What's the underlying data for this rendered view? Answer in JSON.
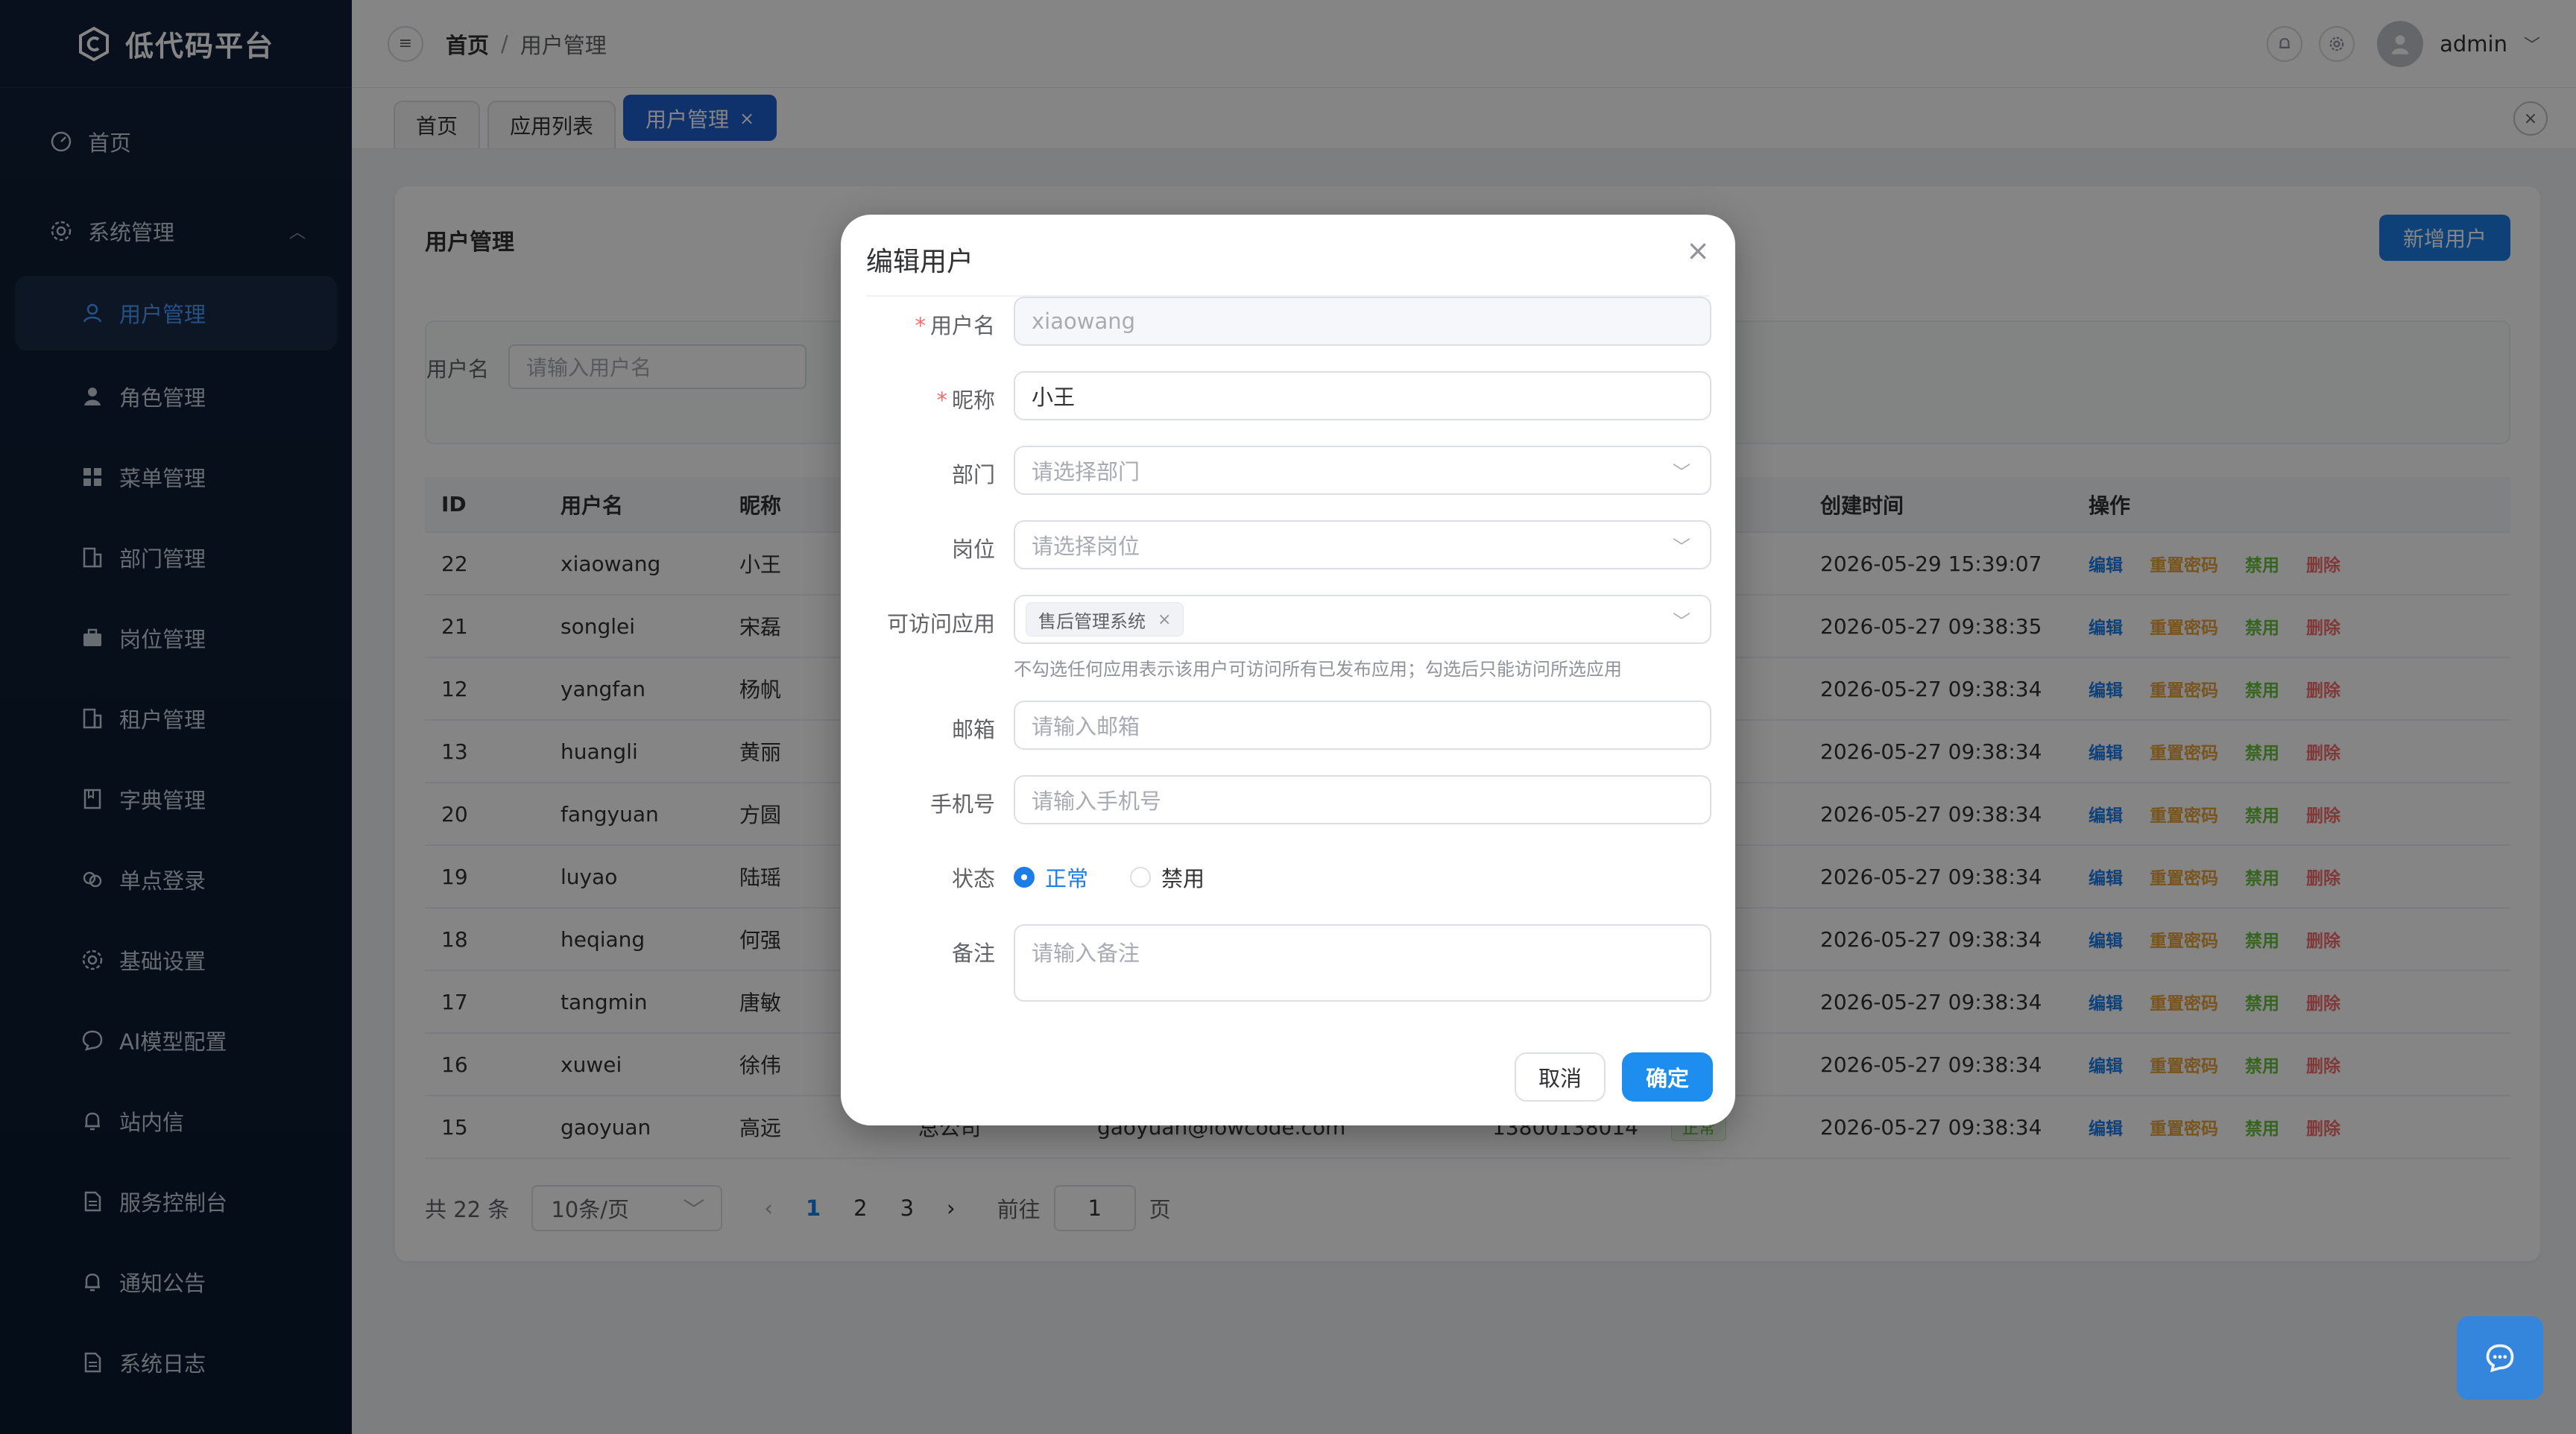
{
  "app": {
    "title": "低代码平台"
  },
  "sidebar": {
    "home": "首页",
    "group": "系统管理",
    "items": [
      {
        "label": "用户管理",
        "icon": "user-icon"
      },
      {
        "label": "角色管理",
        "icon": "role-icon"
      },
      {
        "label": "菜单管理",
        "icon": "menu-grid-icon"
      },
      {
        "label": "部门管理",
        "icon": "building-icon"
      },
      {
        "label": "岗位管理",
        "icon": "briefcase-icon"
      },
      {
        "label": "租户管理",
        "icon": "building-icon"
      },
      {
        "label": "字典管理",
        "icon": "book-icon"
      },
      {
        "label": "单点登录",
        "icon": "link-icon"
      },
      {
        "label": "基础设置",
        "icon": "gear-icon"
      },
      {
        "label": "AI模型配置",
        "icon": "chat-icon"
      },
      {
        "label": "站内信",
        "icon": "bell-icon"
      },
      {
        "label": "服务控制台",
        "icon": "document-icon"
      },
      {
        "label": "通知公告",
        "icon": "bell-icon"
      },
      {
        "label": "系统日志",
        "icon": "document-icon"
      }
    ]
  },
  "header": {
    "breadcrumb": [
      "首页",
      "/",
      "用户管理"
    ],
    "user": "admin"
  },
  "tabs": [
    {
      "label": "首页"
    },
    {
      "label": "应用列表"
    },
    {
      "label": "用户管理",
      "close": "×"
    }
  ],
  "page": {
    "title": "用户管理",
    "add_button": "新增用户",
    "search": {
      "label": "用户名",
      "placeholder": "请输入用户名"
    },
    "columns": [
      "ID",
      "用户名",
      "昵称",
      "",
      "",
      "",
      "",
      "创建时间",
      "操作"
    ],
    "rows": [
      {
        "id": "22",
        "username": "xiaowang",
        "nickname": "小王",
        "created": "2026-05-29 15:39:07"
      },
      {
        "id": "21",
        "username": "songlei",
        "nickname": "宋磊",
        "created": "2026-05-27 09:38:35"
      },
      {
        "id": "12",
        "username": "yangfan",
        "nickname": "杨帆",
        "created": "2026-05-27 09:38:34"
      },
      {
        "id": "13",
        "username": "huangli",
        "nickname": "黄丽",
        "created": "2026-05-27 09:38:34"
      },
      {
        "id": "20",
        "username": "fangyuan",
        "nickname": "方圆",
        "created": "2026-05-27 09:38:34"
      },
      {
        "id": "19",
        "username": "luyao",
        "nickname": "陆瑶",
        "created": "2026-05-27 09:38:34"
      },
      {
        "id": "18",
        "username": "heqiang",
        "nickname": "何强",
        "created": "2026-05-27 09:38:34"
      },
      {
        "id": "17",
        "username": "tangmin",
        "nickname": "唐敏",
        "created": "2026-05-27 09:38:34"
      },
      {
        "id": "16",
        "username": "xuwei",
        "nickname": "徐伟",
        "created": "2026-05-27 09:38:34"
      },
      {
        "id": "15",
        "username": "gaoyuan",
        "nickname": "高远",
        "dept": "总公司",
        "email": "gaoyuan@lowcode.com",
        "phone": "13800138014",
        "status": "正常",
        "created": "2026-05-27 09:38:34"
      }
    ],
    "actions": {
      "edit": "编辑",
      "reset": "重置密码",
      "disable": "禁用",
      "delete": "删除"
    },
    "pager": {
      "total": "共 22 条",
      "size": "10条/页",
      "prev": "‹",
      "pages": [
        "1",
        "2",
        "3"
      ],
      "next": "›",
      "goto": "前往",
      "goto_value": "1",
      "page_word": "页"
    }
  },
  "modal": {
    "title": "编辑用户",
    "close": "×",
    "fields": {
      "username": {
        "label": "用户名",
        "value": "xiaowang"
      },
      "nickname": {
        "label": "昵称",
        "value": "小王"
      },
      "dept": {
        "label": "部门",
        "placeholder": "请选择部门"
      },
      "post": {
        "label": "岗位",
        "placeholder": "请选择岗位"
      },
      "apps": {
        "label": "可访问应用",
        "chip": "售后管理系统",
        "hint": "不勾选任何应用表示该用户可访问所有已发布应用；勾选后只能访问所选应用"
      },
      "email": {
        "label": "邮箱",
        "placeholder": "请输入邮箱"
      },
      "phone": {
        "label": "手机号",
        "placeholder": "请输入手机号"
      },
      "status": {
        "label": "状态",
        "options": [
          "正常",
          "禁用"
        ],
        "selected": "正常"
      },
      "remark": {
        "label": "备注",
        "placeholder": "请输入备注"
      }
    },
    "cancel": "取消",
    "ok": "确定"
  }
}
